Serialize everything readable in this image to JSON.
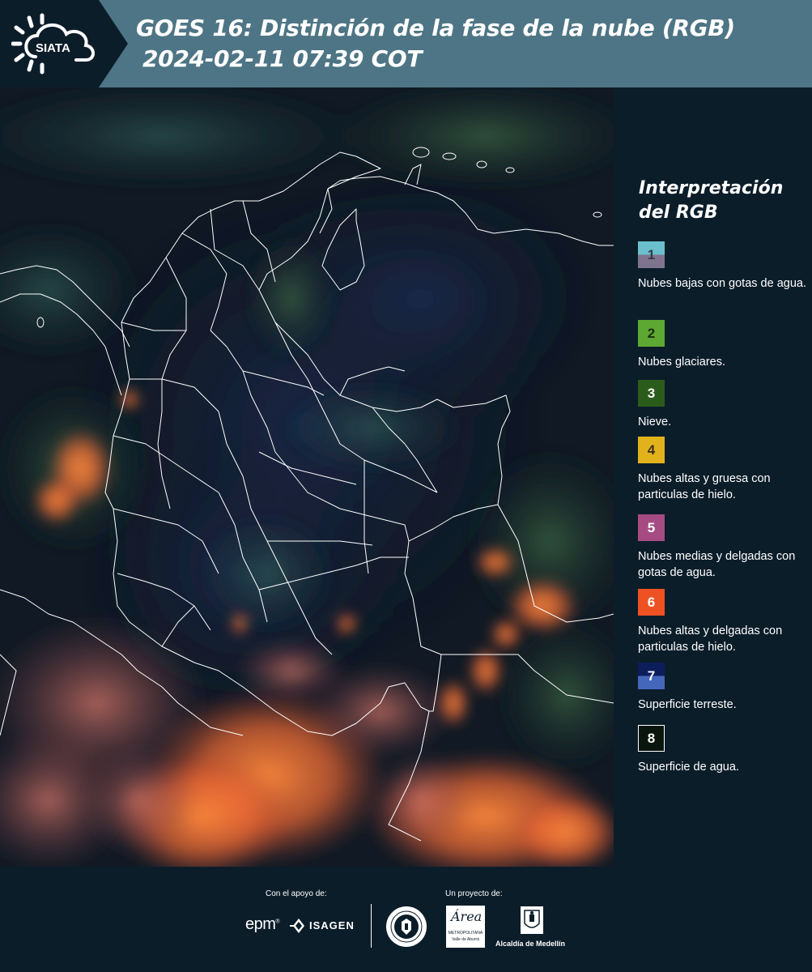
{
  "header": {
    "logo_text": "SIATA",
    "title_line1": "GOES 16: Distinción de la fase de la nube (RGB)",
    "title_line2": "2024-02-11 07:39 COT"
  },
  "legend": {
    "title": "Interpretación del RGB",
    "items": [
      {
        "num": "1",
        "text": "Nubes bajas con gotas de agua.",
        "color_top": "#6bbfcc",
        "color_bottom": "#7f7490"
      },
      {
        "num": "2",
        "text": "Nubes glaciares.",
        "color": "#5da833"
      },
      {
        "num": "3",
        "text": "Nieve.",
        "color": "#2c5c1c"
      },
      {
        "num": "4",
        "text": "Nubes altas y gruesa con particulas de hielo.",
        "color": "#e2b21c"
      },
      {
        "num": "5",
        "text": "Nubes medias y delgadas con gotas de agua.",
        "color": "#a64b82"
      },
      {
        "num": "6",
        "text": "Nubes altas y delgadas con particulas de hielo.",
        "color": "#ee5222"
      },
      {
        "num": "7",
        "text": "Superficie terreste.",
        "color_top": "#0d1d5c",
        "color_bottom": "#4466bb"
      },
      {
        "num": "8",
        "text": "Superficie de agua.",
        "color": "#0a150e"
      }
    ]
  },
  "footer": {
    "support_label": "Con el apoyo de:",
    "project_label": "Un proyecto de:",
    "epm_logo": "epm",
    "isagen_logo": "ISAGEN",
    "area_logo_text": "Área",
    "area_logo_sub1": "METROPOLITANA",
    "area_logo_sub2": "Valle de Aburrá",
    "alcaldia_label": "Alcaldía de Medellín"
  },
  "colors": {
    "background": "#0c1d2a",
    "header_band": "#4e7585",
    "map_dark": "#111a24",
    "cloud_orange": "#f07a3a"
  }
}
